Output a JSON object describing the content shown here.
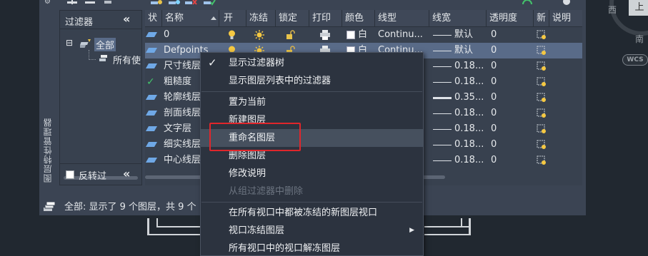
{
  "palette": {
    "side_title": "图层特性管理器"
  },
  "filter_panel": {
    "header": "过滤器",
    "collapse_glyph": "«",
    "tree_expand": "⊟",
    "tree_root": "全部",
    "tree_child": "所有使",
    "invert_label": "反转过",
    "invert_collapse_glyph": "«"
  },
  "table": {
    "columns": [
      "状",
      "名称",
      "开",
      "冻结",
      "锁定",
      "打印",
      "颜色",
      "线型",
      "线宽",
      "透明度",
      "新",
      "说明"
    ],
    "rows": [
      {
        "status": "layer",
        "name": "0",
        "color": "白",
        "linetype": "Continu...",
        "lineweight": "默认",
        "transparency": "0"
      },
      {
        "status": "layer",
        "name": "Defpoints",
        "color": "白",
        "linetype": "Continu...",
        "lineweight": "默认",
        "transparency": "0",
        "selected": true
      },
      {
        "status": "layer",
        "name": "尺寸线层",
        "lineweight": "0.18...",
        "transparency": "0"
      },
      {
        "status": "current",
        "name": "粗糙度",
        "lineweight": "0.18...",
        "transparency": "0"
      },
      {
        "status": "layer",
        "name": "轮廓线层",
        "lineweight": "0.35...",
        "transparency": "0"
      },
      {
        "status": "layer",
        "name": "剖面线层",
        "lineweight": "0.18...",
        "transparency": "0"
      },
      {
        "status": "layer",
        "name": "文字层",
        "lineweight": "0.18...",
        "transparency": "0"
      },
      {
        "status": "layer",
        "name": "细实线层",
        "lineweight": "0.18...",
        "transparency": "0"
      },
      {
        "status": "layer",
        "name": "中心线层",
        "lineweight": "0.18...",
        "transparency": "0"
      }
    ]
  },
  "status_bar": {
    "text": "全部: 显示了 9 个图层，共 9 个"
  },
  "context_menu": {
    "items": [
      {
        "label": "显示过滤器树",
        "checked": true
      },
      {
        "label": "显示图层列表中的过滤器"
      },
      {
        "separator": true
      },
      {
        "label": "置为当前"
      },
      {
        "label": "新建图层"
      },
      {
        "label": "重命名图层",
        "hover": true
      },
      {
        "label": "删除图层"
      },
      {
        "label": "修改说明"
      },
      {
        "label": "从组过滤器中删除",
        "disabled": true
      },
      {
        "separator": true
      },
      {
        "label": "在所有视口中都被冻结的新图层视口"
      },
      {
        "label": "视口冻结图层",
        "submenu": true
      },
      {
        "label": "所有视口中的视口解冻图层"
      }
    ],
    "checkmark_glyph": "✓",
    "submenu_glyph": "▶"
  },
  "viewcube": {
    "west": "西",
    "south": "南",
    "face": "上",
    "wcs": "WCS"
  },
  "colors": {
    "highlight_box": "#e0262b",
    "selected_row": "#596b88",
    "menu_bg": "#2c333f"
  }
}
